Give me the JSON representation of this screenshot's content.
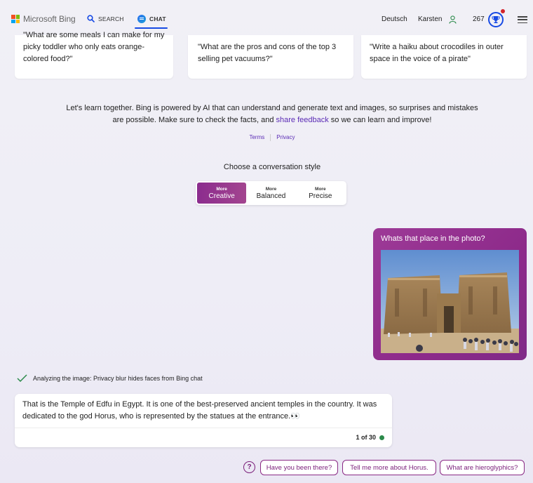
{
  "header": {
    "logo_text": "Microsoft Bing",
    "logo_colors": [
      "#f25022",
      "#7fba00",
      "#00a4ef",
      "#ffb900"
    ],
    "search_label": "SEARCH",
    "chat_label": "CHAT",
    "language": "Deutsch",
    "user_name": "Karsten",
    "reward_points": "267",
    "accent_color": "#174ae4"
  },
  "suggestions": [
    "\"What are some meals I can make for my picky toddler who only eats orange-colored food?\"",
    "\"What are the pros and cons of the top 3 selling pet vacuums?\"",
    "\"Write a haiku about crocodiles in outer space in the voice of a pirate\""
  ],
  "disclaimer": {
    "text_before": "Let's learn together. Bing is powered by AI that can understand and generate text and images, so surprises and mistakes are possible. Make sure to check the facts, and ",
    "link": "share feedback",
    "text_after": " so we can learn and improve!",
    "terms": "Terms",
    "privacy": "Privacy"
  },
  "conversation_style": {
    "title": "Choose a conversation style",
    "options": [
      {
        "top": "More",
        "label": "Creative",
        "active": true
      },
      {
        "top": "More",
        "label": "Balanced",
        "active": false
      },
      {
        "top": "More",
        "label": "Precise",
        "active": false
      }
    ]
  },
  "user_message": {
    "text": "Whats that place in the photo?"
  },
  "analyzing": "Analyzing the image: Privacy blur hides faces from Bing chat",
  "bot_message": {
    "text": "That is the Temple of Edfu in Egypt. It is one of the best-preserved ancient temples in the country. It was dedicated to the god Horus, who is represented by the statues at the entrance.👀",
    "count": "1 of 30"
  },
  "followups": [
    "Have you been there?",
    "Tell me more about Horus.",
    "What are hieroglyphics?"
  ],
  "colors": {
    "creative_gradient_start": "#8b2c8e",
    "user_bubble": "#9d3a97",
    "link": "#5b2bb5",
    "status_green": "#2b8a4a"
  }
}
